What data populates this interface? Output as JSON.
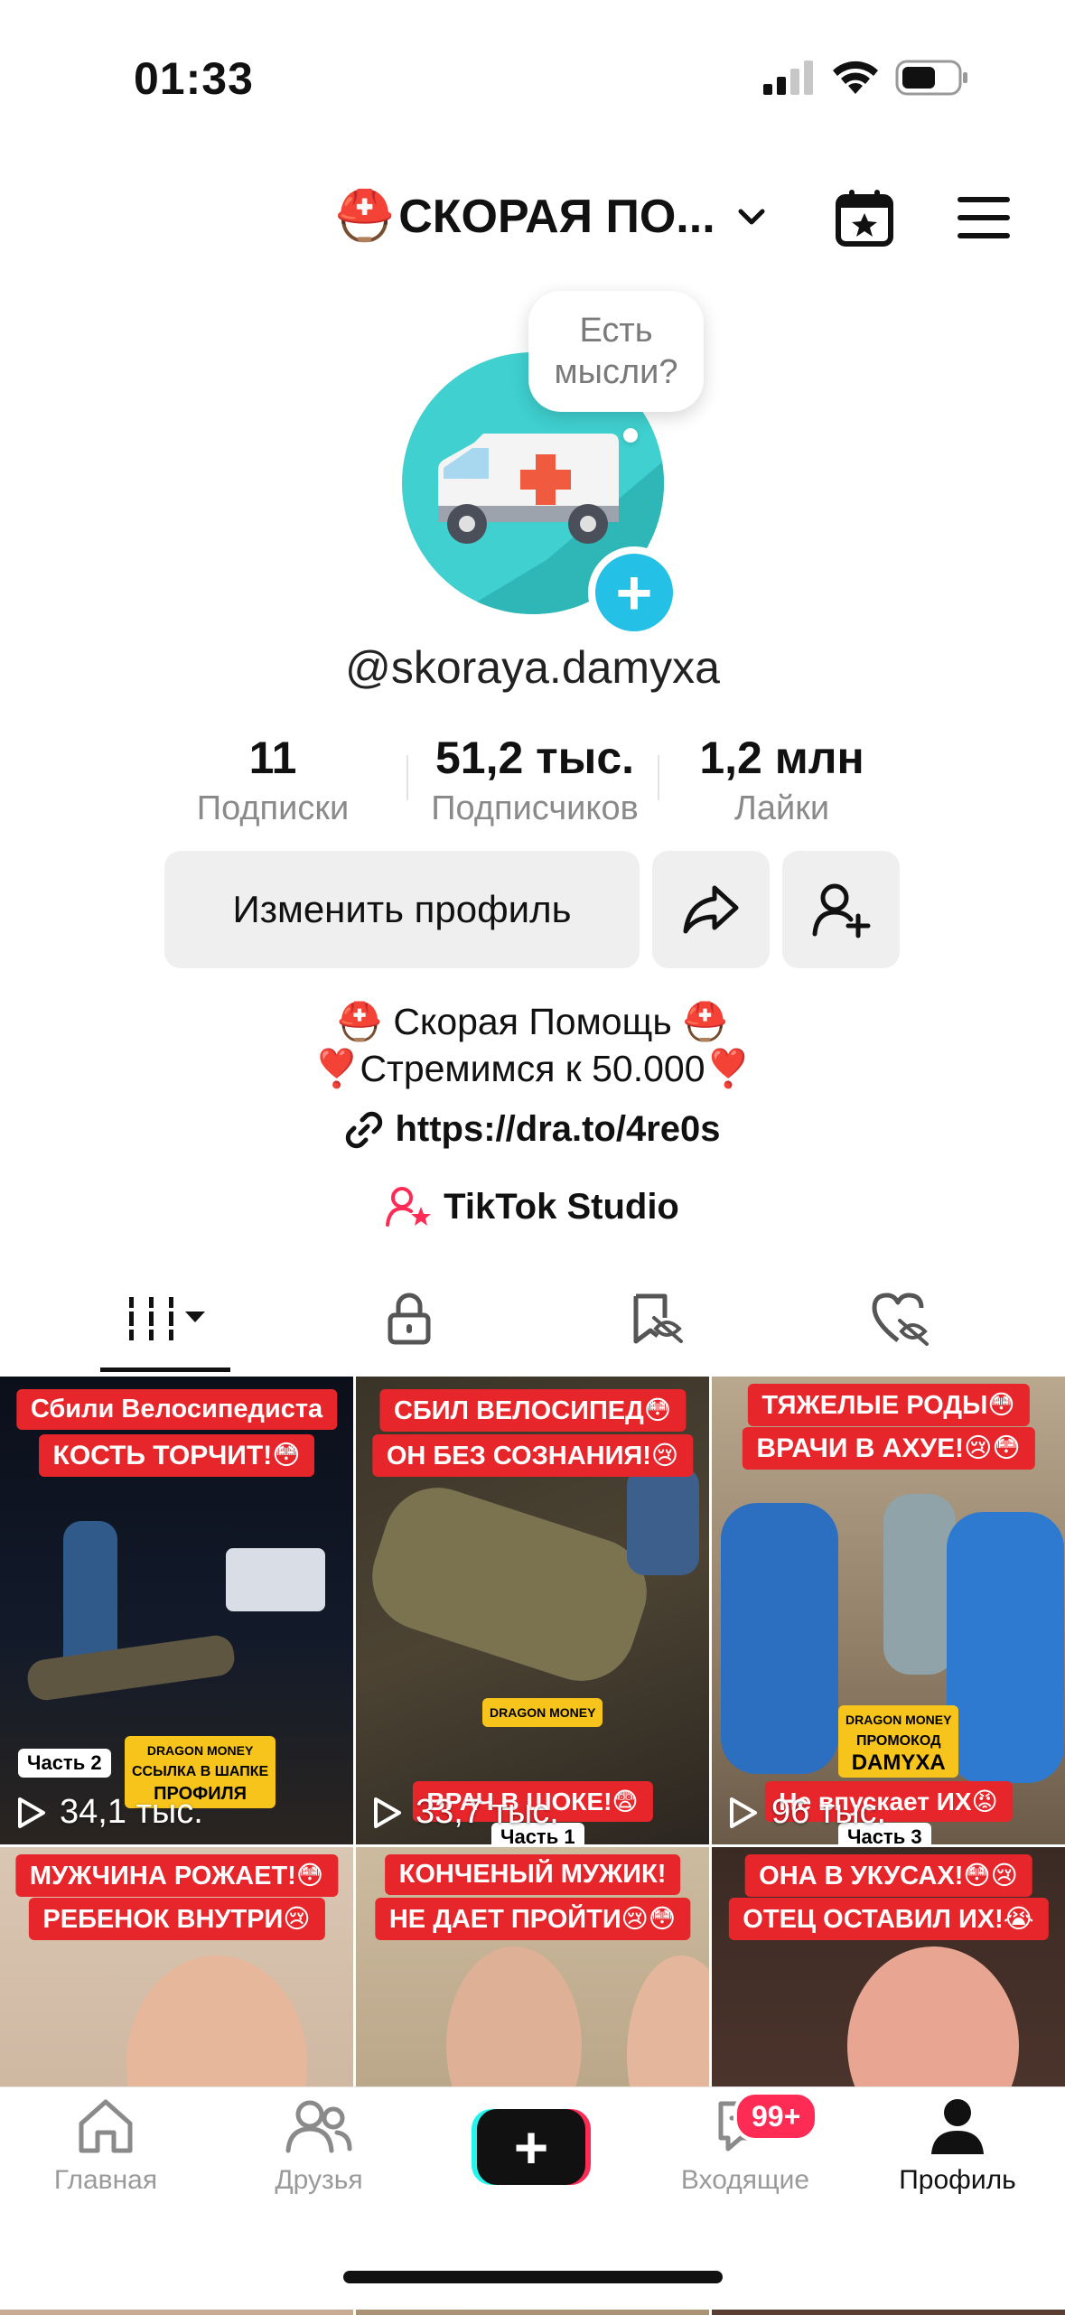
{
  "status_bar": {
    "time": "01:33"
  },
  "header": {
    "account_name": "СКОРАЯ ПО...",
    "account_emoji": "⛑️"
  },
  "avatar": {
    "bubble_line1": "Есть",
    "bubble_line2": "мысли?"
  },
  "profile": {
    "username": "@skoraya.damyxa",
    "stats": [
      {
        "value": "11",
        "label": "Подписки"
      },
      {
        "value": "51,2 тыс.",
        "label": "Подписчиков"
      },
      {
        "value": "1,2 млн",
        "label": "Лайки"
      }
    ],
    "edit_button": "Изменить профиль",
    "bio_line1": "⛑️ Скорая Помощь ⛑️",
    "bio_line2": "❣️Стремимся к 50.000❣️",
    "link": "https://dra.to/4re0s",
    "studio": "TikTok Studio"
  },
  "tabs": [
    "videos-grid",
    "private",
    "reposts",
    "liked"
  ],
  "videos": [
    {
      "cap1": "Сбили Велосипедиста",
      "cap2": "КОСТЬ ТОРЧИТ!😳",
      "views": "34,1 тыс.",
      "part": "Часть 2",
      "promo1": "DRAGON MONEY",
      "promo2": "ССЫЛКА В ШАПКЕ",
      "promo3": "ПРОФИЛЯ",
      "bottom_cap": ""
    },
    {
      "cap1": "СБИЛ ВЕЛОСИПЕД😳",
      "cap2": "ОН БЕЗ СОЗНАНИЯ!😢",
      "views": "33,7 тыс.",
      "part": "Часть 1",
      "promo1": "DRAGON MONEY",
      "promo2": "",
      "promo3": "",
      "bottom_cap": "ВРАЧ В ШОКЕ!😨"
    },
    {
      "cap1": "ТЯЖЕЛЫЕ РОДЫ😳",
      "cap2": "ВРАЧИ В АХУЕ!😢😳",
      "views": "96 тыс.",
      "part": "Часть 3",
      "promo1": "DRAGON MONEY",
      "promo2": "ПРОМОКОД",
      "promo3": "DAMYXA",
      "bottom_cap": "Не впускает ИХ😡"
    },
    {
      "cap1": "МУЖЧИНА РОЖАЕТ!😳",
      "cap2": "РЕБЕНОК ВНУТРИ😢",
      "views": "",
      "part": "",
      "promo1": "",
      "promo2": "",
      "promo3": "",
      "bottom_cap": ""
    },
    {
      "cap1": "КОНЧЕНЫЙ МУЖИК!",
      "cap2": "НЕ ДАЕТ ПРОЙТИ😢😳",
      "views": "",
      "part": "",
      "promo1": "",
      "promo2": "",
      "promo3": "",
      "bottom_cap": ""
    },
    {
      "cap1": "ОНА В УКУСАХ!😳😢",
      "cap2": "ОТЕЦ ОСТАВИЛ ИХ!😭",
      "views": "",
      "part": "",
      "promo1": "",
      "promo2": "",
      "promo3": "",
      "bottom_cap": ""
    }
  ],
  "bottom_nav": {
    "home": "Главная",
    "friends": "Друзья",
    "inbox": "Входящие",
    "inbox_badge": "99+",
    "profile": "Профиль"
  }
}
